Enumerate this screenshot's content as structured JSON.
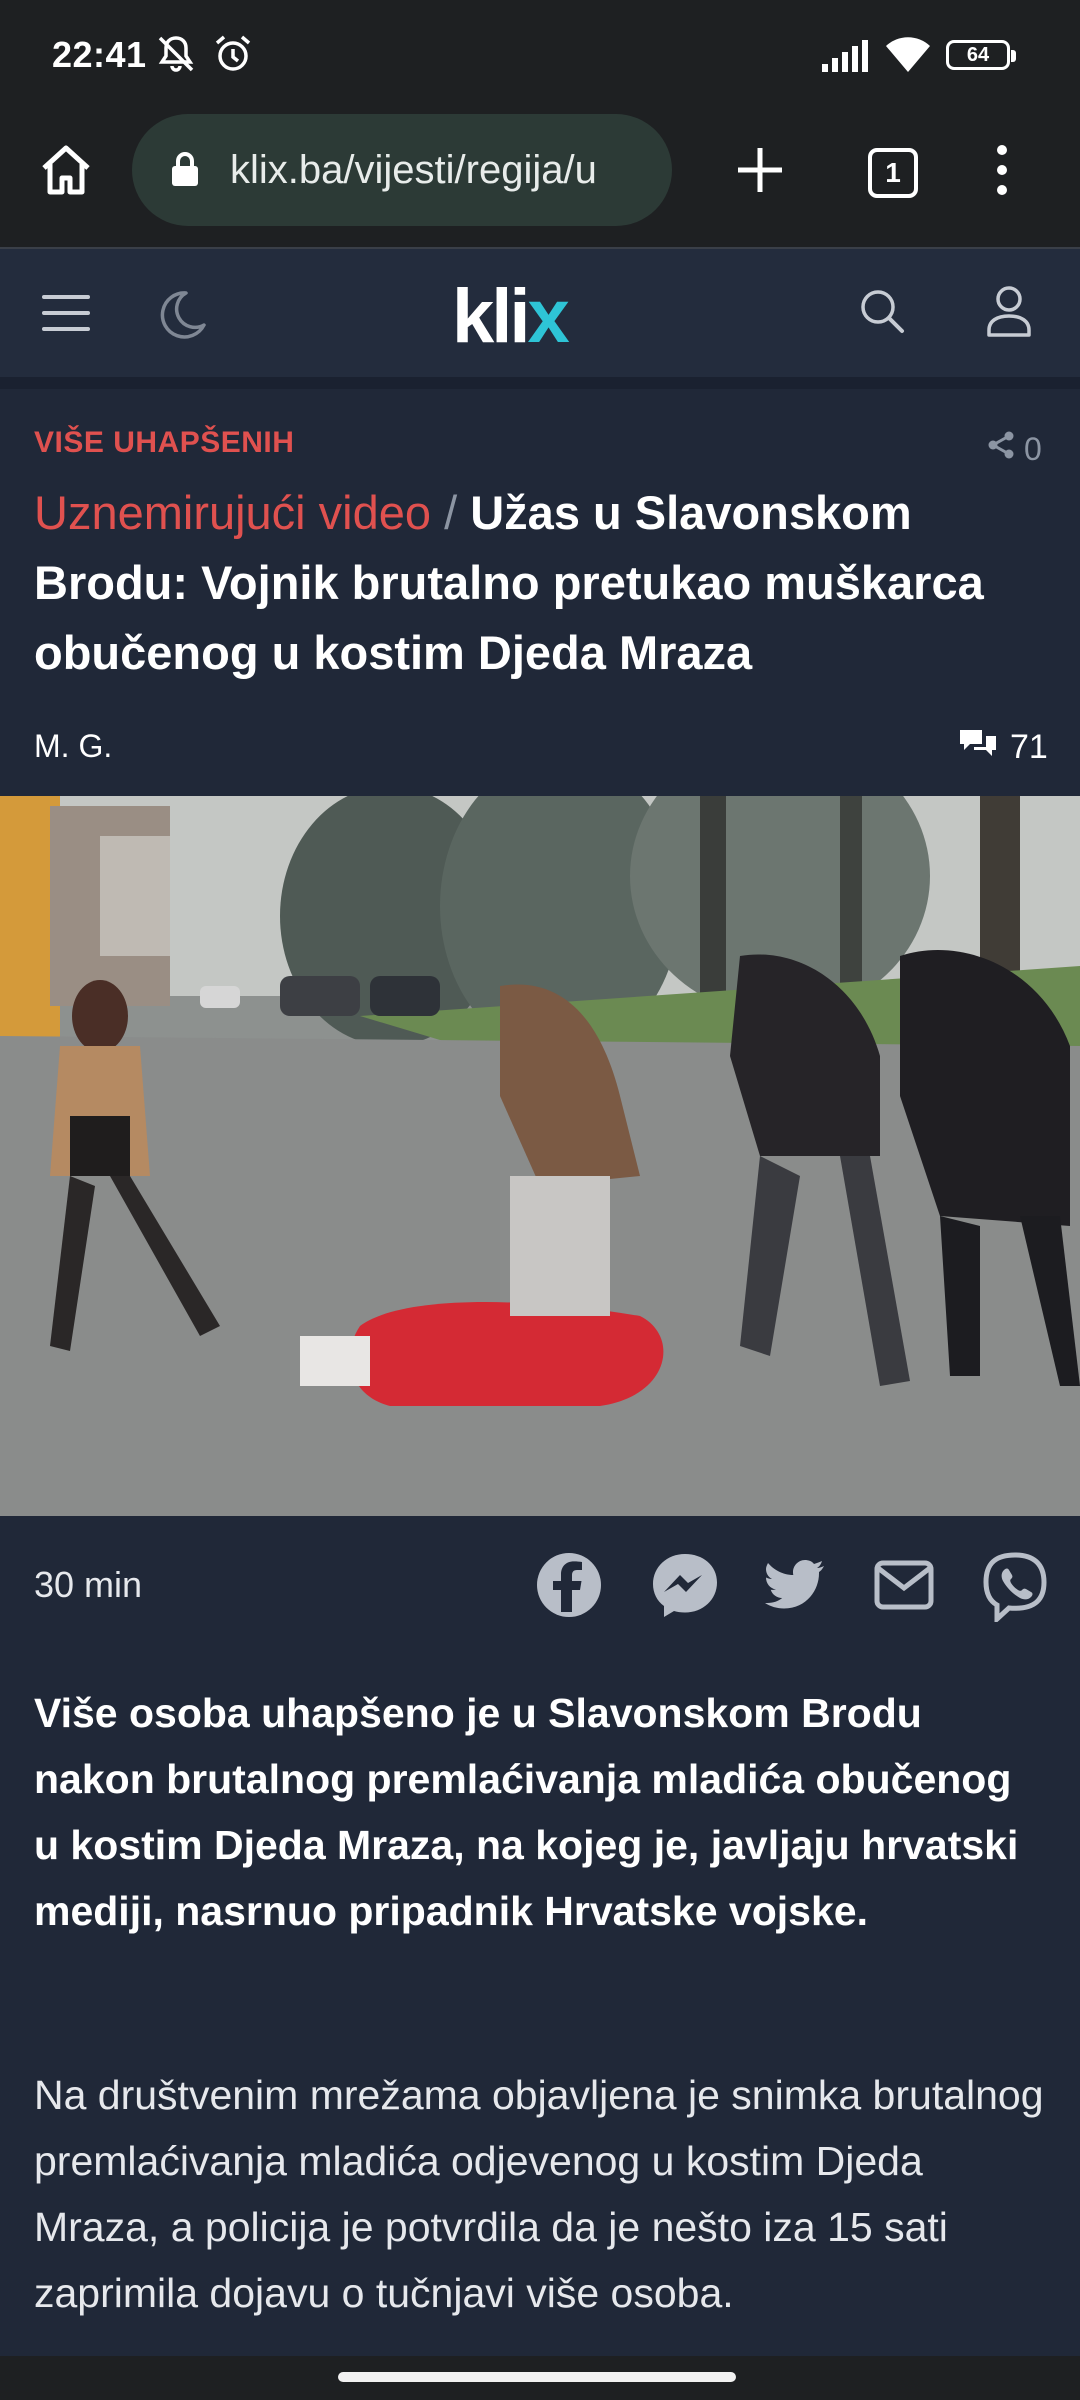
{
  "status_bar": {
    "time": "22:41",
    "battery": "64",
    "icons": [
      "mute-icon",
      "alarm-icon",
      "signal-icon",
      "wifi-icon",
      "battery-icon"
    ]
  },
  "browser": {
    "url": "klix.ba/vijesti/regija/u",
    "tab_count": "1",
    "icons": [
      "home-icon",
      "lock-icon",
      "new-tab-icon",
      "tabs-icon",
      "more-vert-icon"
    ]
  },
  "site_header": {
    "logo_main": "kli",
    "logo_accent": "x",
    "icons": [
      "menu-icon",
      "moon-icon",
      "search-icon",
      "user-icon"
    ]
  },
  "article": {
    "kicker": "VIŠE UHAPŠENIH",
    "share_count": "0",
    "headline_red": "Uznemirujući video",
    "headline_sep": "/",
    "headline_main": "Užas u Slavonskom Brodu: Vojnik brutalno pretukao muškarca obučenog u kostim Djeda Mraza",
    "author": "M. G.",
    "comment_count": "71",
    "time_ago": "30 min",
    "share_icons": [
      "facebook-icon",
      "messenger-icon",
      "twitter-icon",
      "mail-icon",
      "viber-icon"
    ],
    "lead": "Više osoba uhapšeno je u Slavonskom Brodu nakon brutalnog premlaćivanja mladića obučenog u kostim Djeda Mraza, na kojeg je, javljaju hrvatski mediji, nasrnuo pripadnik Hrvatske vojske.",
    "body": "Na društvenim mrežama objavljena je snimka brutalnog premlaćivanja mladića odjevenog u kostim Djeda Mraza, a policija je potvrdila da je nešto iza 15 sati zaprimila dojavu o tučnjavi više osoba."
  },
  "colors": {
    "page_bg": "#202838",
    "header_bg": "#232c3d",
    "accent_red": "#e0514f",
    "logo_cyan": "#2ec4d6",
    "browser_bg": "#1e2022"
  }
}
